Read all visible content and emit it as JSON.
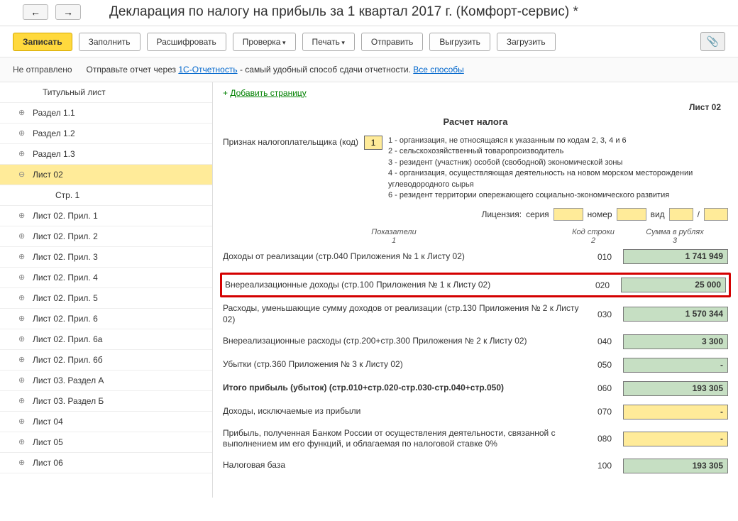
{
  "header": {
    "title": "Декларация по налогу на прибыль за 1 квартал 2017 г. (Комфорт-сервис) *"
  },
  "toolbar": {
    "save": "Записать",
    "fill": "Заполнить",
    "decode": "Расшифровать",
    "check": "Проверка",
    "print": "Печать",
    "send": "Отправить",
    "export": "Выгрузить",
    "import": "Загрузить"
  },
  "status": {
    "state": "Не отправлено",
    "hint_pre": "Отправьте отчет через ",
    "link1": "1С-Отчетность",
    "hint_mid": " - самый удобный способ сдачи отчетности. ",
    "link2": "Все способы"
  },
  "sidebar": {
    "items": [
      {
        "label": "Титульный лист",
        "cls": "first"
      },
      {
        "label": "Раздел 1.1",
        "cls": "expandable"
      },
      {
        "label": "Раздел 1.2",
        "cls": "expandable"
      },
      {
        "label": "Раздел 1.3",
        "cls": "expandable"
      },
      {
        "label": "Лист 02",
        "cls": "expandable expanded selected"
      },
      {
        "label": "Стр. 1",
        "cls": "child"
      },
      {
        "label": "Лист 02. Прил. 1",
        "cls": "expandable"
      },
      {
        "label": "Лист 02. Прил. 2",
        "cls": "expandable"
      },
      {
        "label": "Лист 02. Прил. 3",
        "cls": "expandable"
      },
      {
        "label": "Лист 02. Прил. 4",
        "cls": "expandable"
      },
      {
        "label": "Лист 02. Прил. 5",
        "cls": "expandable"
      },
      {
        "label": "Лист 02. Прил. 6",
        "cls": "expandable"
      },
      {
        "label": "Лист 02. Прил. 6а",
        "cls": "expandable"
      },
      {
        "label": "Лист 02. Прил. 6б",
        "cls": "expandable"
      },
      {
        "label": "Лист 03. Раздел А",
        "cls": "expandable"
      },
      {
        "label": "Лист 03. Раздел Б",
        "cls": "expandable"
      },
      {
        "label": "Лист 04",
        "cls": "expandable"
      },
      {
        "label": "Лист 05",
        "cls": "expandable"
      },
      {
        "label": "Лист 06",
        "cls": "expandable"
      }
    ]
  },
  "content": {
    "add_plus": "+",
    "add_page": "Добавить страницу",
    "sheet": "Лист 02",
    "calc_title": "Расчет налога",
    "taxpayer_label": "Признак налогоплательщика (код)",
    "taxpayer_code": "1",
    "codes": {
      "c1": "1 - организация, не относящаяся к указанным по кодам 2, 3, 4 и 6",
      "c2": "2 - сельскохозяйственный товаропроизводитель",
      "c3": "3 - резидент (участник) особой (свободной) экономической зоны",
      "c4": "4 - организация, осуществляющая деятельность на новом морском месторождении углеводородного сырья",
      "c6": "6 - резидент территории опережающего социально-экономического развития"
    },
    "license": {
      "label": "Лицензия:",
      "series": "серия",
      "number": "номер",
      "type": "вид",
      "sep": "/"
    },
    "cols": {
      "ind": "Показатели",
      "ind_n": "1",
      "code": "Код строки",
      "code_n": "2",
      "sum": "Сумма в рублях",
      "sum_n": "3"
    },
    "rows": [
      {
        "label": "Доходы от реализации (стр.040 Приложения № 1 к Листу 02)",
        "code": "010",
        "value": "1 741 949",
        "style": "val-green"
      },
      {
        "label": "Внереализационные доходы (стр.100 Приложения № 1 к Листу 02)",
        "code": "020",
        "value": "25 000",
        "style": "val-green",
        "hl": true
      },
      {
        "label": "Расходы, уменьшающие сумму доходов от реализации (стр.130 Приложения № 2 к Листу 02)",
        "code": "030",
        "value": "1 570 344",
        "style": "val-green"
      },
      {
        "label": "Внереализационные расходы (стр.200+стр.300 Приложения № 2 к Листу 02)",
        "code": "040",
        "value": "3 300",
        "style": "val-green"
      },
      {
        "label": "Убытки (стр.360 Приложения № 3 к Листу 02)",
        "code": "050",
        "value": "-",
        "style": "val-green"
      },
      {
        "label": "Итого прибыль (убыток)  (стр.010+стр.020-стр.030-стр.040+стр.050)",
        "code": "060",
        "value": "193 305",
        "style": "val-green",
        "bold": true
      },
      {
        "label": "Доходы, исключаемые из прибыли",
        "code": "070",
        "value": "-",
        "style": "val-yellow"
      },
      {
        "label": "Прибыль, полученная Банком России от осуществления деятельности, связанной с выполнением им его функций, и облагаемая по налоговой ставке 0%",
        "code": "080",
        "value": "-",
        "style": "val-yellow"
      },
      {
        "label": "Налоговая база",
        "code": "100",
        "value": "193 305",
        "style": "val-green"
      }
    ]
  }
}
